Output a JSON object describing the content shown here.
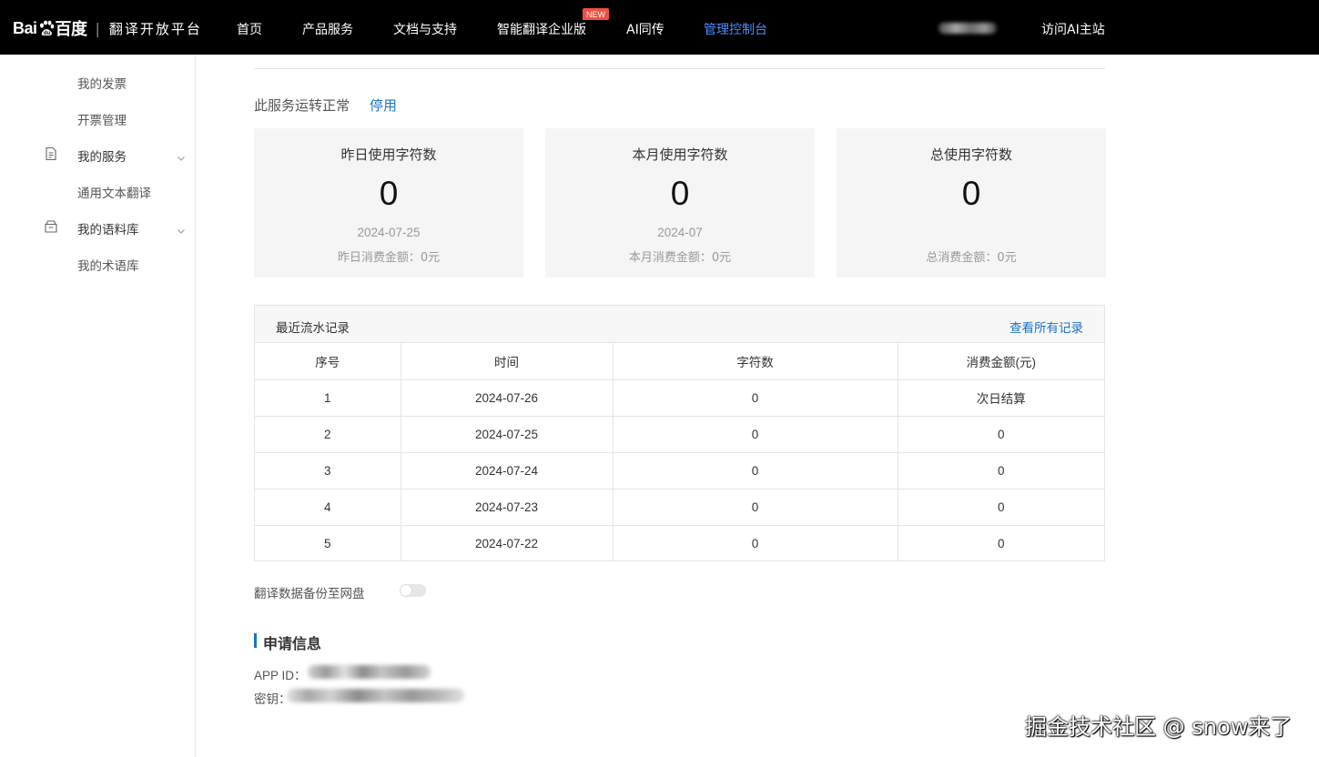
{
  "header": {
    "logo_text_left": "Bai",
    "logo_text_right": "百度",
    "platform_name": "翻译开放平台",
    "nav": [
      {
        "label": "首页"
      },
      {
        "label": "产品服务"
      },
      {
        "label": "文档与支持"
      },
      {
        "label": "智能翻译企业版",
        "badge": "NEW"
      },
      {
        "label": "AI同传"
      },
      {
        "label": "管理控制台",
        "active": true
      }
    ],
    "visit_link": "访问AI主站"
  },
  "sidebar": {
    "items": [
      {
        "label": "我的发票"
      },
      {
        "label": "开票管理"
      },
      {
        "label": "我的服务",
        "icon": "document-icon",
        "expandable": true
      },
      {
        "label": "通用文本翻译"
      },
      {
        "label": "我的语料库",
        "icon": "box-icon",
        "expandable": true
      },
      {
        "label": "我的术语库"
      }
    ]
  },
  "service": {
    "status_text": "此服务运转正常",
    "disable_link": "停用"
  },
  "cards": [
    {
      "title": "昨日使用字符数",
      "value": "0",
      "date": "2024-07-25",
      "amount": "昨日消费金额：0元"
    },
    {
      "title": "本月使用字符数",
      "value": "0",
      "date": "2024-07",
      "amount": "本月消费金额：0元"
    },
    {
      "title": "总使用字符数",
      "value": "0",
      "date": "",
      "amount": "总消费金额：0元"
    }
  ],
  "records": {
    "title": "最近流水记录",
    "view_all": "查看所有记录",
    "columns": [
      "序号",
      "时间",
      "字符数",
      "消费金额(元)"
    ],
    "rows": [
      [
        "1",
        "2024-07-26",
        "0",
        "次日结算"
      ],
      [
        "2",
        "2024-07-25",
        "0",
        "0"
      ],
      [
        "3",
        "2024-07-24",
        "0",
        "0"
      ],
      [
        "4",
        "2024-07-23",
        "0",
        "0"
      ],
      [
        "5",
        "2024-07-22",
        "0",
        "0"
      ]
    ]
  },
  "backup": {
    "label": "翻译数据备份至网盘",
    "enabled": false
  },
  "application_info": {
    "title": "申请信息",
    "app_id_label": "APP ID：",
    "secret_label": "密钥："
  },
  "watermark": "掘金技术社区 @ snow来了",
  "colors": {
    "topbar": "#000000",
    "nav_active": "#4e8cff",
    "link": "#1a73c8",
    "card_bg": "#f5f5f5",
    "badge": "#f04f43"
  }
}
